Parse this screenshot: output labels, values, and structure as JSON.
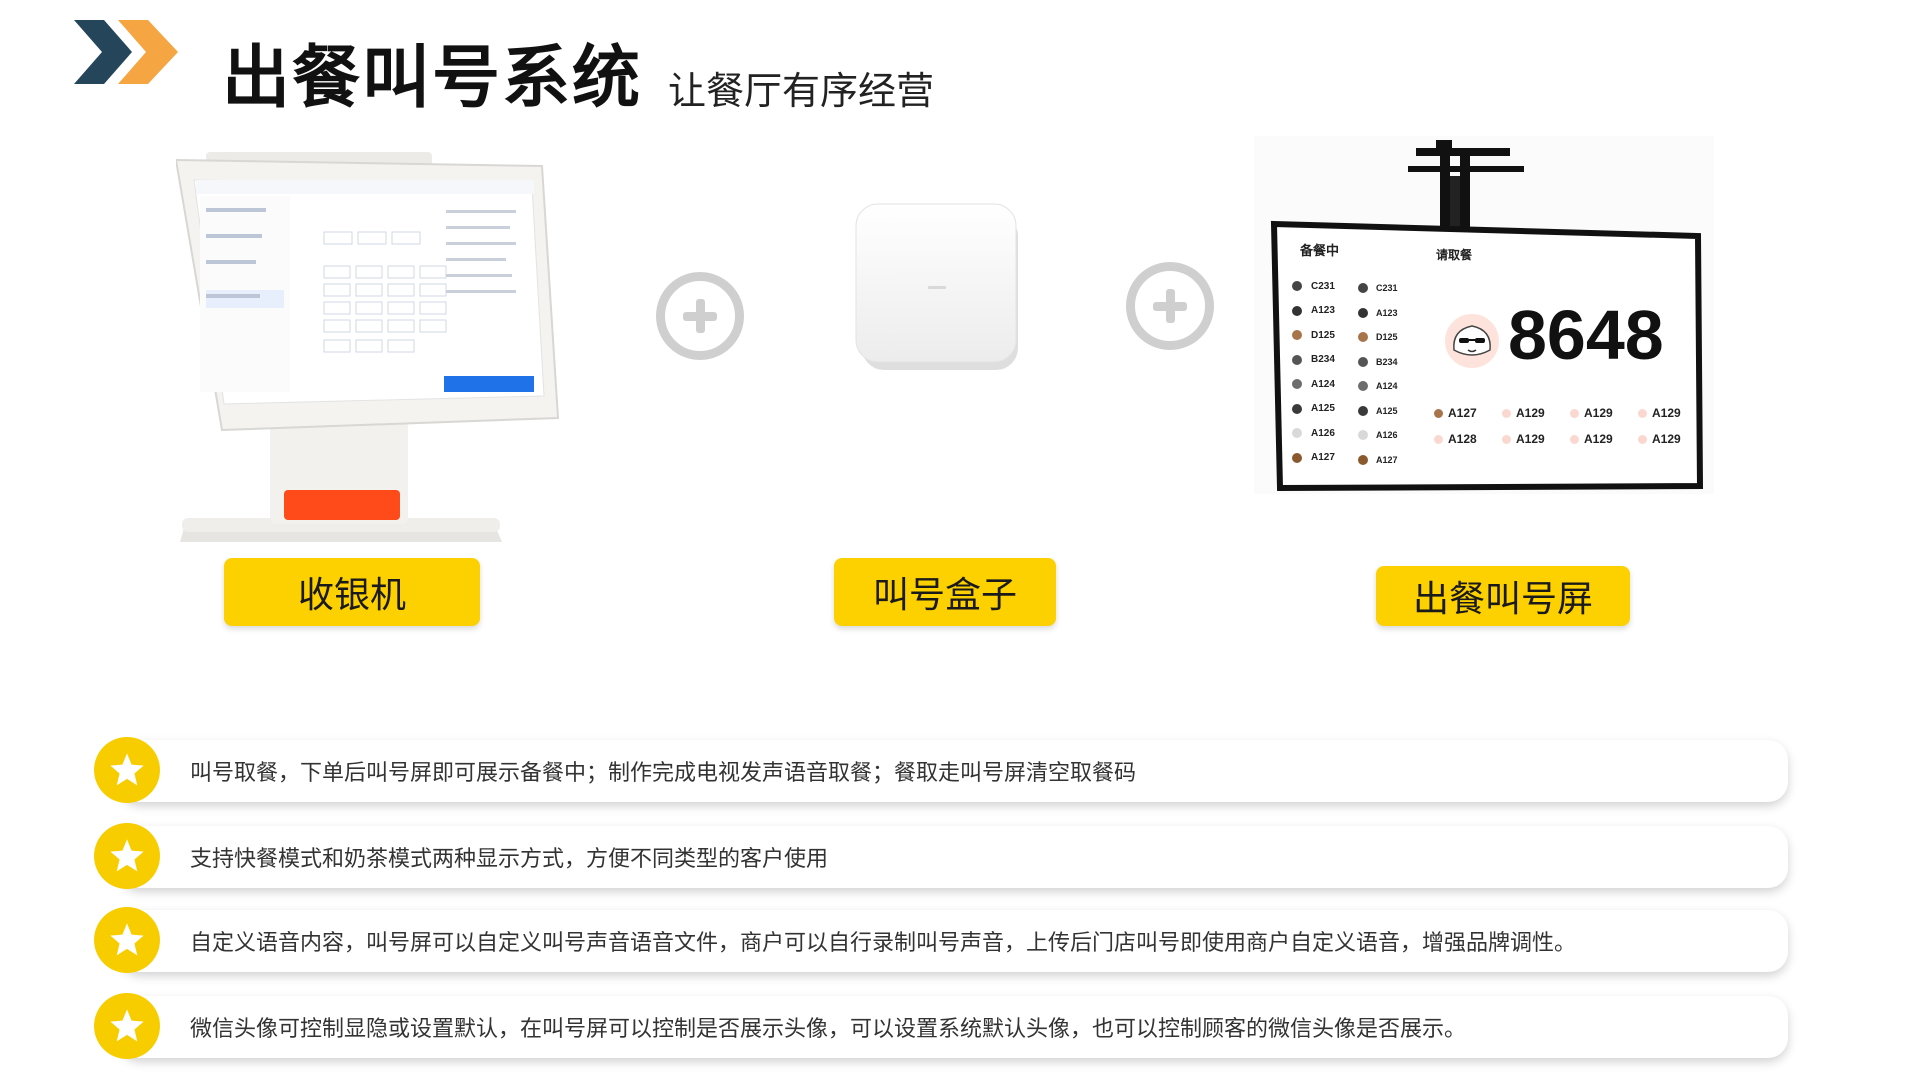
{
  "header": {
    "title": "出餐叫号系统",
    "subtitle": "让餐厅有序经营",
    "chevron_colors": [
      "#24455a",
      "#f5a541"
    ]
  },
  "products": [
    {
      "name": "收银机",
      "icon": "pos-terminal"
    },
    {
      "name": "叫号盒子",
      "icon": "call-box"
    },
    {
      "name": "出餐叫号屏",
      "icon": "call-display-screen"
    }
  ],
  "call_screen": {
    "preparing_title": "备餐中",
    "pickup_title": "请取餐",
    "current_number": "8648",
    "preparing_col1": [
      "C231",
      "A123",
      "D125",
      "B234",
      "A124",
      "A125",
      "A126",
      "A127"
    ],
    "preparing_col2": [
      "C231",
      "A123",
      "D125",
      "B234",
      "A124",
      "A125",
      "A126",
      "A127"
    ],
    "pickup_row1": [
      "A127",
      "A129",
      "A129",
      "A129"
    ],
    "pickup_row2": [
      "A128",
      "A129",
      "A129",
      "A129"
    ]
  },
  "features": [
    "叫号取餐，下单后叫号屏即可展示备餐中；制作完成电视发声语音取餐；餐取走叫号屏清空取餐码",
    "支持快餐模式和奶茶模式两种显示方式，方便不同类型的客户使用",
    "自定义语音内容，叫号屏可以自定义叫号声音语音文件，商户可以自行录制叫号声音，上传后门店叫号即使用商户自定义语音，增强品牌调性。",
    "微信头像可控制显隐或设置默认，在叫号屏可以控制是否展示头像，可以设置系统默认头像，也可以控制顾客的微信头像是否展示。"
  ],
  "colors": {
    "accent_yellow": "#fdd000",
    "star_yellow": "#f7cd00",
    "plus_gray": "#cfcfcf"
  }
}
